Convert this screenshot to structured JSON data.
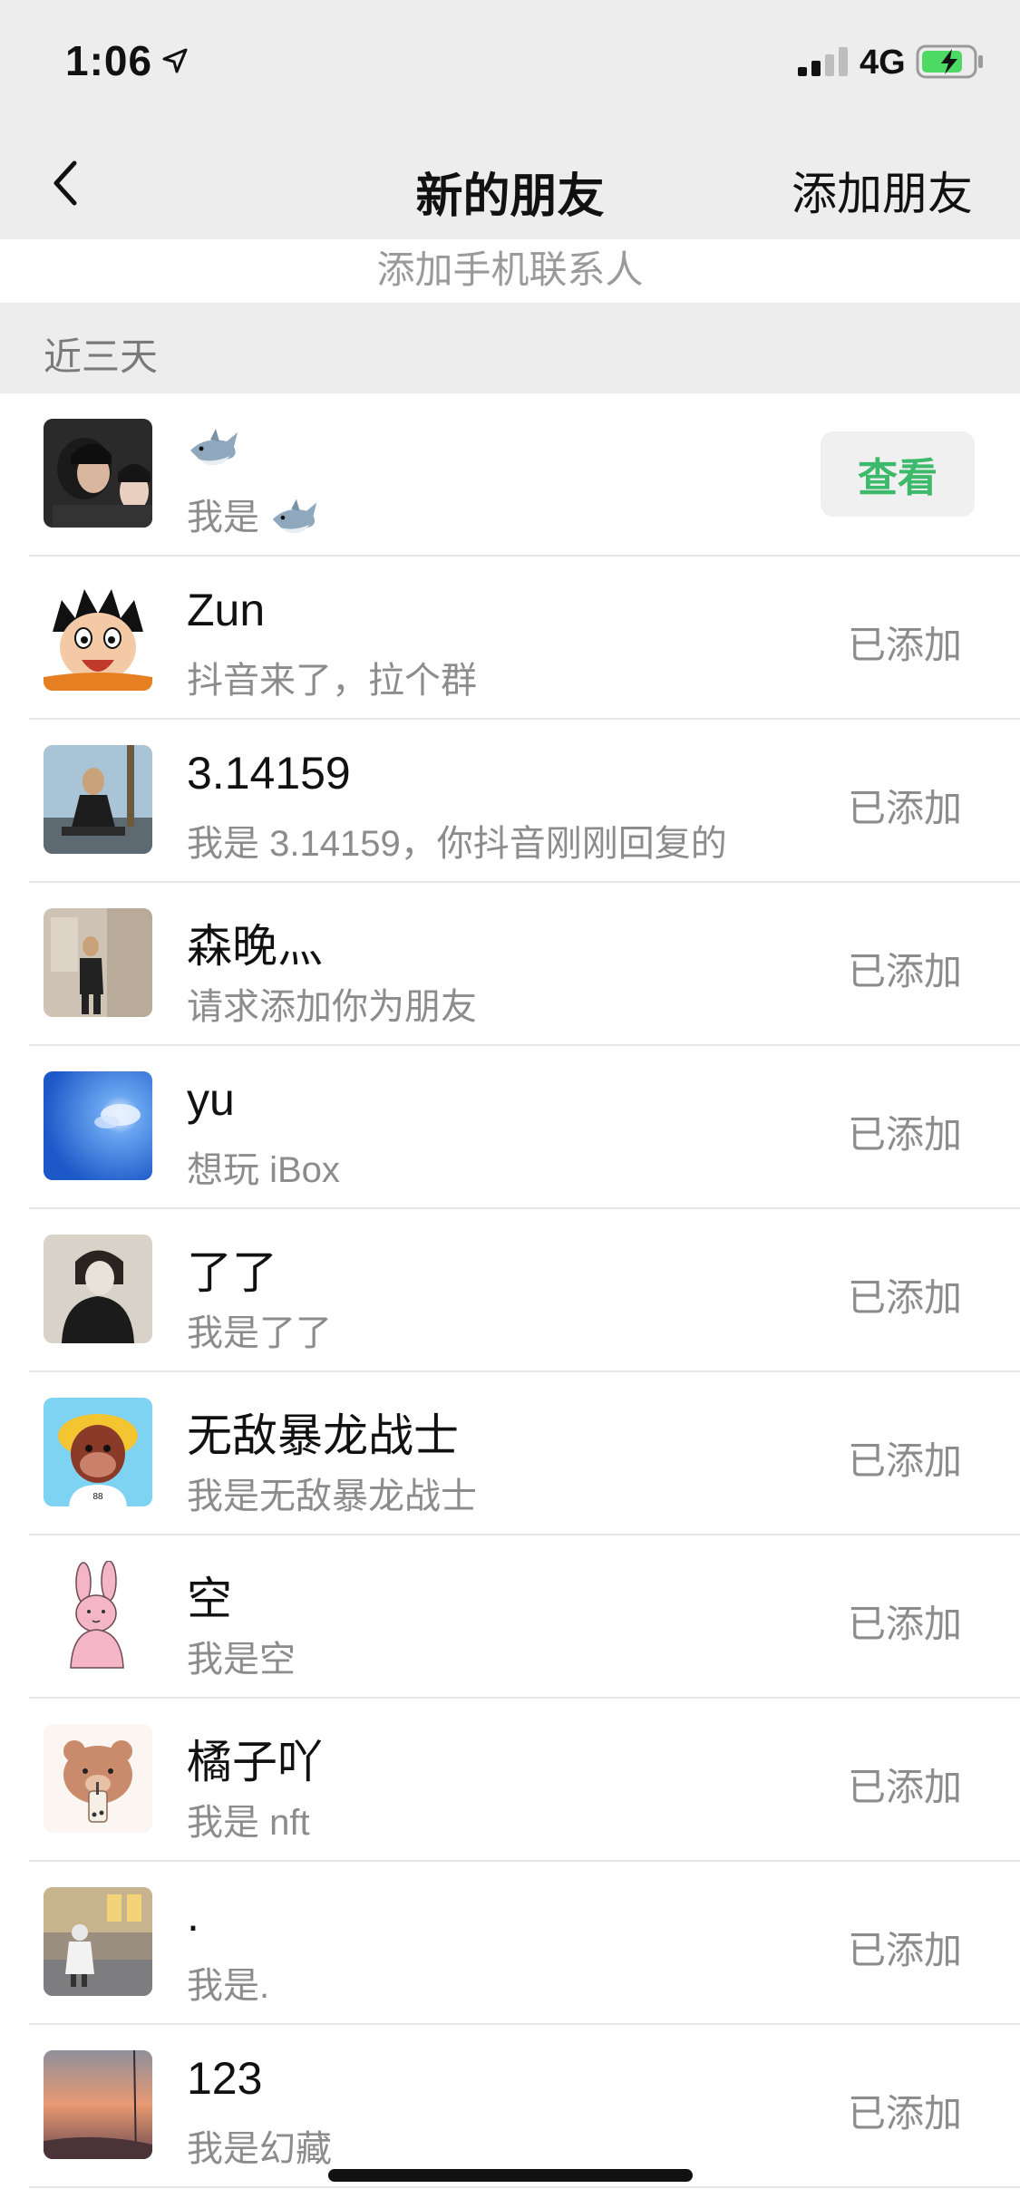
{
  "status_bar": {
    "time": "1:06",
    "network": "4G",
    "icons": [
      "location-arrow-icon",
      "signal-bars-icon",
      "battery-charging-icon"
    ]
  },
  "nav": {
    "back_icon": "chevron-left-icon",
    "title": "新的朋友",
    "action_label": "添加朋友"
  },
  "mobile_contacts_label": "添加手机联系人",
  "section": {
    "title": "近三天"
  },
  "colors": {
    "background_gray": "#ededed",
    "accent_green": "#3cb96a",
    "secondary_text": "#8c8c8c"
  },
  "requests": [
    {
      "name": "",
      "name_icon": "shark-emoji-icon",
      "message": "我是",
      "message_icon": "shark-emoji-icon",
      "action": "查看",
      "avatar_icon": "couple-photo-avatar"
    },
    {
      "name": "Zun",
      "message": "抖音来了，拉个群",
      "status": "已添加",
      "avatar_icon": "cartoon-boy-avatar"
    },
    {
      "name": "3.14159",
      "message": "我是 3.14159，你抖音刚刚回复的",
      "status": "已添加",
      "avatar_icon": "person-sitting-photo-avatar"
    },
    {
      "name": "森晚灬",
      "message": "请求添加你为朋友",
      "status": "已添加",
      "avatar_icon": "person-standing-photo-avatar"
    },
    {
      "name": "yu",
      "message": "想玩 iBox",
      "status": "已添加",
      "avatar_icon": "blue-sky-photo-avatar"
    },
    {
      "name": "了了",
      "message": "我是了了",
      "status": "已添加",
      "avatar_icon": "masked-person-avatar"
    },
    {
      "name": "无敌暴龙战士",
      "message": "我是无敌暴龙战士",
      "status": "已添加",
      "avatar_icon": "ape-nft-avatar"
    },
    {
      "name": "空",
      "message": "我是空",
      "status": "已添加",
      "avatar_icon": "pink-rabbit-avatar"
    },
    {
      "name": "橘子吖",
      "message": "我是 nft",
      "status": "已添加",
      "avatar_icon": "bear-bubble-tea-avatar"
    },
    {
      "name": ".",
      "message": "我是.",
      "status": "已添加",
      "avatar_icon": "child-photo-avatar"
    },
    {
      "name": "123",
      "message": "我是幻藏",
      "status": "已添加",
      "avatar_icon": "sunset-photo-avatar"
    }
  ]
}
